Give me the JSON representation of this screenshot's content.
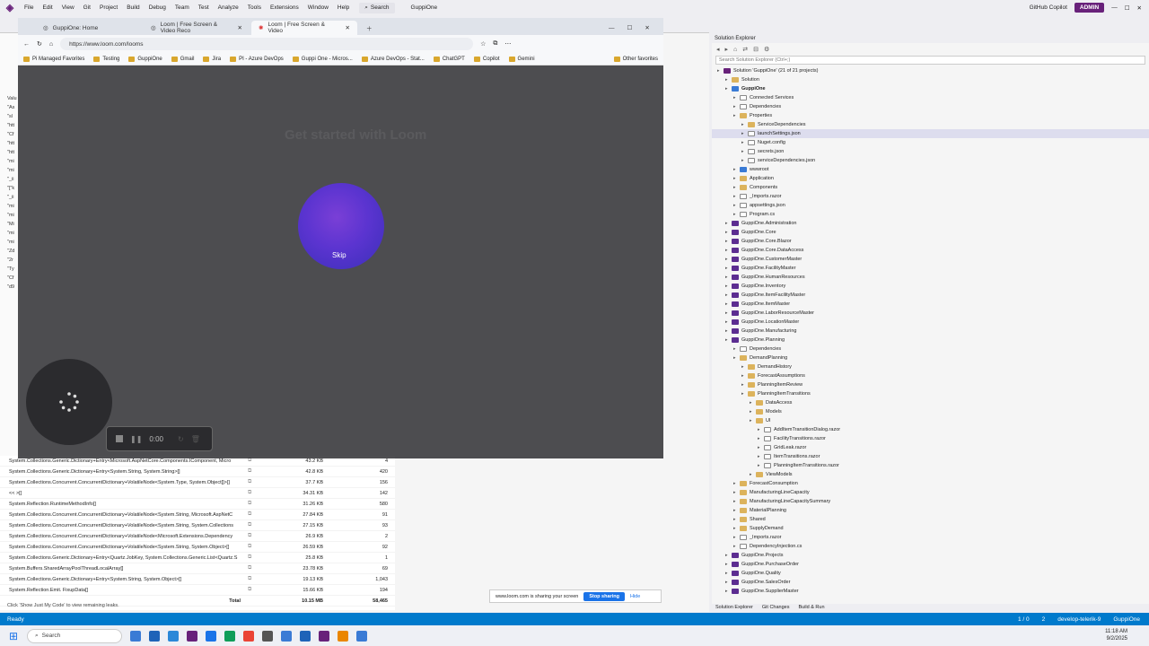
{
  "vs": {
    "menu": [
      "File",
      "Edit",
      "View",
      "Git",
      "Project",
      "Build",
      "Debug",
      "Team",
      "Test",
      "Analyze",
      "Tools",
      "Extensions",
      "Window",
      "Help"
    ],
    "search_label": "Search",
    "solution_name": "GuppiOne",
    "copilot_label": "GitHub Copilot",
    "admin_badge": "ADMIN"
  },
  "browser": {
    "tabs": [
      "GuppiOne: Home",
      "Loom | Free Screen & Video Reco",
      "Loom | Free Screen & Video"
    ],
    "url": "https://www.loom.com/looms",
    "favorites": [
      "Pi Managed Favorites",
      "Testing",
      "GuppiOne",
      "Gmail",
      "Jira",
      "PI - Azure DevOps",
      "Guppi One - Micros...",
      "Azure DevOps - Stat...",
      "ChatGPT",
      "Copilot",
      "Gemini"
    ],
    "other_favorites": "Other favorites"
  },
  "loom": {
    "bg_heading": "Get started with Loom",
    "skip_label": "Skip",
    "timer": "0:00"
  },
  "memory": {
    "rows": [
      {
        "name": "System.Collections.Generic.Dictionary+Entry<Microsoft.AspNetCore.Components.IComponent, Micro",
        "size": "43.2 KB",
        "count": "4"
      },
      {
        "name": "System.Collections.Generic.Dictionary+Entry<System.String, System.String>[]",
        "size": "42.8 KB",
        "count": "420"
      },
      {
        "name": "System.Collections.Concurrent.ConcurrentDictionary+VolatileNode<System.Type, System.Object[]>[]",
        "size": "37.7 KB",
        "count": "156"
      },
      {
        "name": "  <<  >[]",
        "size": "34.31 KB",
        "count": "142"
      },
      {
        "name": "System.Reflection.RuntimeMethodInfo[]",
        "size": "31.26 KB",
        "count": "580"
      },
      {
        "name": "System.Collections.Concurrent.ConcurrentDictionary+VolatileNode<System.String, Microsoft.AspNetC",
        "size": "27.84 KB",
        "count": "91"
      },
      {
        "name": "System.Collections.Concurrent.ConcurrentDictionary+VolatileNode<System.String, System.Collections",
        "size": "27.15 KB",
        "count": "93"
      },
      {
        "name": "System.Collections.Concurrent.ConcurrentDictionary+VolatileNode<Microsoft.Extensions.Dependency",
        "size": "26.9 KB",
        "count": "2"
      },
      {
        "name": "System.Collections.Concurrent.ConcurrentDictionary+VolatileNode<System.String, System.Object>[]",
        "size": "26.59 KB",
        "count": "92"
      },
      {
        "name": "System.Collections.Generic.Dictionary+Entry<Quartz.JobKey, System.Collections.Generic.List<Quartz.S",
        "size": "25.8 KB",
        "count": "1"
      },
      {
        "name": "System.Buffers.SharedArrayPoolThreadLocalArray[]",
        "size": "23.78 KB",
        "count": "69"
      },
      {
        "name": "System.Collections.Generic.Dictionary+Entry<System.String, System.Object>[]",
        "size": "19.13 KB",
        "count": "1,043"
      },
      {
        "name": "System.Reflection.Emit.  FixupData[]",
        "size": "15.66 KB",
        "count": "194"
      }
    ],
    "total_label": "Total",
    "total_size": "10.15 MB",
    "total_count": "58,465",
    "hint": "Click 'Show Just My Code' to view remaining leaks."
  },
  "left_labels": [
    "Valu",
    "\"As",
    "\"sl",
    "\"htt",
    "\"Cf",
    "\"htt",
    "\"htt",
    "\"mi",
    "\"mi",
    "\"_ii",
    "\"[\"k",
    "\"_ii",
    "\"mi",
    "\"mi",
    "\"Mi",
    "\"mi",
    "\"mi",
    "\"Zd",
    "\"2r",
    "\"Ty",
    "\"Cf",
    "\"d9"
  ],
  "solution_explorer": {
    "title": "Solution Explorer",
    "search_placeholder": "Search Solution Explorer (Ctrl+;)",
    "tree": [
      {
        "label": "Solution 'GuppiOne' (21 of 21 projects)",
        "indent": 0,
        "icon": "sln"
      },
      {
        "label": "Solution",
        "indent": 1,
        "icon": "fold"
      },
      {
        "label": "GuppiOne",
        "indent": 1,
        "icon": "web",
        "bold": true
      },
      {
        "label": "Connected Services",
        "indent": 2,
        "icon": "file"
      },
      {
        "label": "Dependencies",
        "indent": 2,
        "icon": "file"
      },
      {
        "label": "Properties",
        "indent": 2,
        "icon": "fold"
      },
      {
        "label": "ServiceDependencies",
        "indent": 3,
        "icon": "fold"
      },
      {
        "label": "launchSettings.json",
        "indent": 3,
        "icon": "file",
        "sel": true
      },
      {
        "label": "Nuget.config",
        "indent": 3,
        "icon": "file"
      },
      {
        "label": "secrets.json",
        "indent": 3,
        "icon": "file"
      },
      {
        "label": "serviceDependencies.json",
        "indent": 3,
        "icon": "file"
      },
      {
        "label": "wwwroot",
        "indent": 2,
        "icon": "web"
      },
      {
        "label": "Application",
        "indent": 2,
        "icon": "fold"
      },
      {
        "label": "Components",
        "indent": 2,
        "icon": "fold"
      },
      {
        "label": "_Imports.razor",
        "indent": 2,
        "icon": "file"
      },
      {
        "label": "appsettings.json",
        "indent": 2,
        "icon": "file"
      },
      {
        "label": "Program.cs",
        "indent": 2,
        "icon": "file"
      },
      {
        "label": "GuppiOne.Administration",
        "indent": 1,
        "icon": "proj"
      },
      {
        "label": "GuppiOne.Core",
        "indent": 1,
        "icon": "proj"
      },
      {
        "label": "GuppiOne.Core.Blazor",
        "indent": 1,
        "icon": "proj"
      },
      {
        "label": "GuppiOne.Core.DataAccess",
        "indent": 1,
        "icon": "proj"
      },
      {
        "label": "GuppiOne.CustomerMaster",
        "indent": 1,
        "icon": "proj"
      },
      {
        "label": "GuppiOne.FacilityMaster",
        "indent": 1,
        "icon": "proj"
      },
      {
        "label": "GuppiOne.HumanResources",
        "indent": 1,
        "icon": "proj"
      },
      {
        "label": "GuppiOne.Inventory",
        "indent": 1,
        "icon": "proj"
      },
      {
        "label": "GuppiOne.ItemFacilityMaster",
        "indent": 1,
        "icon": "proj"
      },
      {
        "label": "GuppiOne.ItemMaster",
        "indent": 1,
        "icon": "proj"
      },
      {
        "label": "GuppiOne.LaborResourceMaster",
        "indent": 1,
        "icon": "proj"
      },
      {
        "label": "GuppiOne.LocationMaster",
        "indent": 1,
        "icon": "proj"
      },
      {
        "label": "GuppiOne.Manufacturing",
        "indent": 1,
        "icon": "proj"
      },
      {
        "label": "GuppiOne.Planning",
        "indent": 1,
        "icon": "proj"
      },
      {
        "label": "Dependencies",
        "indent": 2,
        "icon": "file"
      },
      {
        "label": "DemandPlanning",
        "indent": 2,
        "icon": "fold"
      },
      {
        "label": "DemandHistory",
        "indent": 3,
        "icon": "fold"
      },
      {
        "label": "ForecastAssumptions",
        "indent": 3,
        "icon": "fold"
      },
      {
        "label": "PlanningItemReview",
        "indent": 3,
        "icon": "fold"
      },
      {
        "label": "PlanningItemTransitions",
        "indent": 3,
        "icon": "fold"
      },
      {
        "label": "DataAccess",
        "indent": 4,
        "icon": "fold"
      },
      {
        "label": "Models",
        "indent": 4,
        "icon": "fold"
      },
      {
        "label": "UI",
        "indent": 4,
        "icon": "fold"
      },
      {
        "label": "AddItemTransitionDialog.razor",
        "indent": 5,
        "icon": "file"
      },
      {
        "label": "FacilityTransitions.razor",
        "indent": 5,
        "icon": "file"
      },
      {
        "label": "GridLeak.razor",
        "indent": 5,
        "icon": "file"
      },
      {
        "label": "ItemTransitions.razor",
        "indent": 5,
        "icon": "file"
      },
      {
        "label": "PlanningItemTransitions.razor",
        "indent": 5,
        "icon": "file"
      },
      {
        "label": "ViewModels",
        "indent": 4,
        "icon": "fold"
      },
      {
        "label": "ForecastConsumption",
        "indent": 2,
        "icon": "fold"
      },
      {
        "label": "ManufacturingLineCapacity",
        "indent": 2,
        "icon": "fold"
      },
      {
        "label": "ManufacturingLineCapacitySummary",
        "indent": 2,
        "icon": "fold"
      },
      {
        "label": "MaterialPlanning",
        "indent": 2,
        "icon": "fold"
      },
      {
        "label": "Shared",
        "indent": 2,
        "icon": "fold"
      },
      {
        "label": "SupplyDemand",
        "indent": 2,
        "icon": "fold"
      },
      {
        "label": "_Imports.razor",
        "indent": 2,
        "icon": "file"
      },
      {
        "label": "DependencyInjection.cs",
        "indent": 2,
        "icon": "file"
      },
      {
        "label": "GuppiOne.Projects",
        "indent": 1,
        "icon": "proj"
      },
      {
        "label": "GuppiOne.PurchaseOrder",
        "indent": 1,
        "icon": "proj"
      },
      {
        "label": "GuppiOne.Quality",
        "indent": 1,
        "icon": "proj"
      },
      {
        "label": "GuppiOne.SalesOrder",
        "indent": 1,
        "icon": "proj"
      },
      {
        "label": "GuppiOne.SupplierMaster",
        "indent": 1,
        "icon": "proj"
      }
    ],
    "bottom_tabs": [
      "Solution Explorer",
      "Git Changes",
      "Build & Run"
    ]
  },
  "sharing": {
    "message": "www.loom.com is sharing your screen",
    "stop_label": "Stop sharing",
    "hide_label": "Hide"
  },
  "status": {
    "left": "Ready",
    "lines": "1 / 0",
    "edits": "2",
    "branch": "develop-telerik-9",
    "repo": "GuppiOne"
  },
  "taskbar": {
    "search_placeholder": "Search",
    "time": "11:18 AM",
    "date": "9/2/2025"
  },
  "colors": {
    "accent": "#007acc",
    "loom_purple": "#5b34d0",
    "vs_purple": "#68217a"
  }
}
